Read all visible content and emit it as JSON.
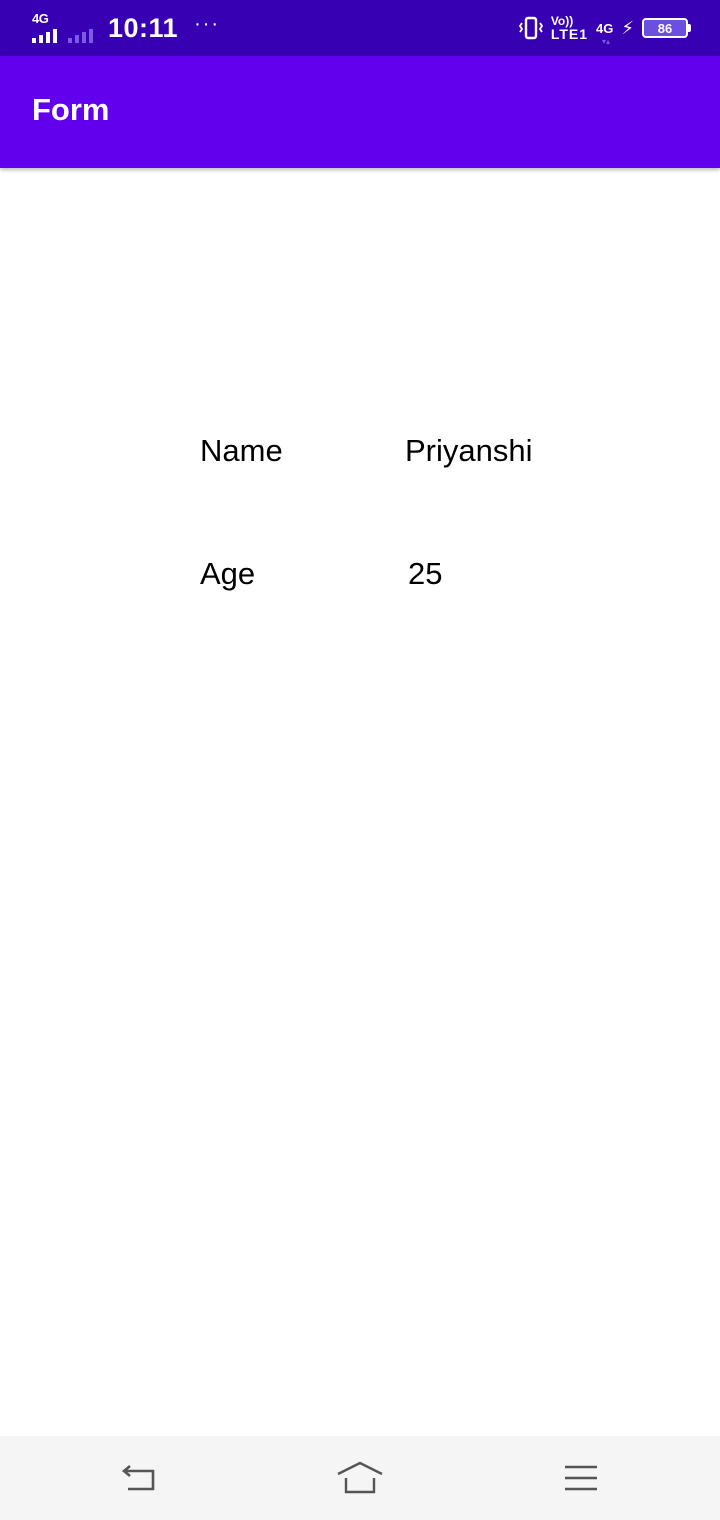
{
  "status_bar": {
    "network_left": "4G",
    "time": "10:11",
    "more": "···",
    "volte": "Vo))",
    "lte": "LTE1",
    "network_right": "4G",
    "battery": "86"
  },
  "app_bar": {
    "title": "Form"
  },
  "form": {
    "rows": [
      {
        "label": "Name",
        "value": "Priyanshi"
      },
      {
        "label": "Age",
        "value": "25"
      }
    ]
  },
  "nav_bar": {
    "buttons": [
      "back-icon",
      "home-icon",
      "menu-icon"
    ]
  },
  "colors": {
    "status_bar": "#3700b3",
    "app_bar": "#6200ee",
    "nav_bar": "#f5f5f5"
  }
}
